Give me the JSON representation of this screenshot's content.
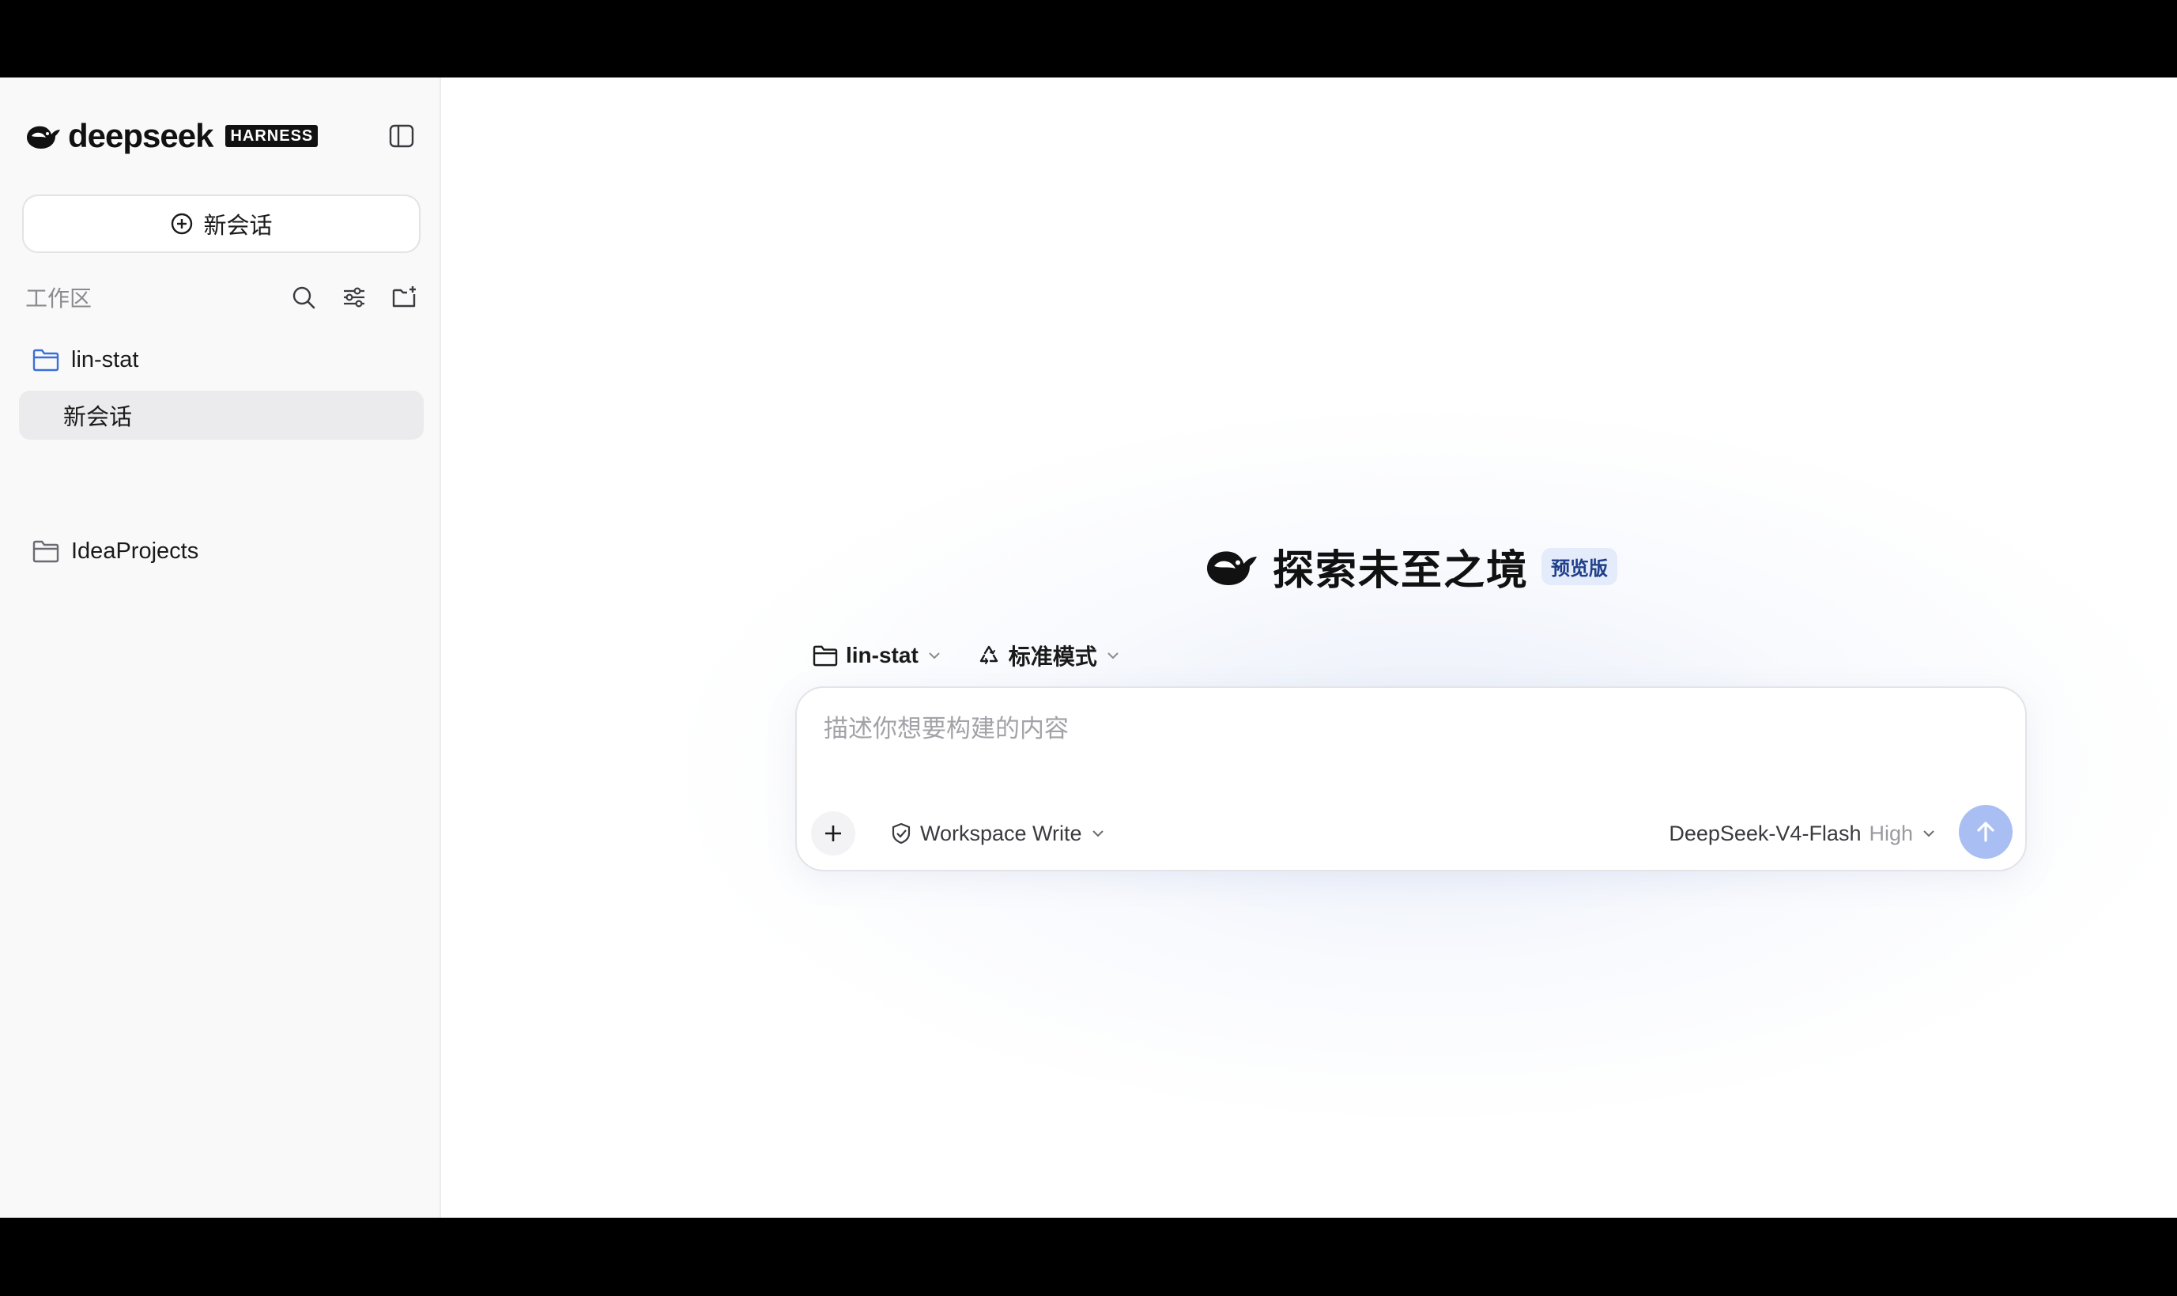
{
  "brand": {
    "name": "deepseek",
    "badge": "HARNESS"
  },
  "sidebar": {
    "new_chat_label": "新会话",
    "section_label": "工作区",
    "workspaces": [
      {
        "label": "lin-stat",
        "active": true
      },
      {
        "label": "IdeaProjects",
        "active": false
      }
    ],
    "chats": [
      {
        "label": "新会话"
      }
    ]
  },
  "hero": {
    "title": "探索未至之境",
    "badge": "预览版"
  },
  "selectors": {
    "project": "lin-stat",
    "mode": "标准模式"
  },
  "composer": {
    "placeholder": "描述你想要构建的内容",
    "permission": "Workspace Write",
    "model": "DeepSeek-V4-Flash",
    "level": "High"
  },
  "colors": {
    "accent_folder": "#3b6fd8",
    "send_button": "#a9bff3",
    "badge_bg": "#e4ecfb"
  },
  "icons": {
    "toggle": "sidebar-toggle-icon",
    "new_chat": "plus-circle-icon",
    "search": "search-icon",
    "filter": "sliders-icon",
    "new_folder": "folder-plus-icon",
    "folder": "folder-icon",
    "mode": "recycle-icon",
    "permission": "shield-check-icon",
    "send": "arrow-up-icon"
  }
}
